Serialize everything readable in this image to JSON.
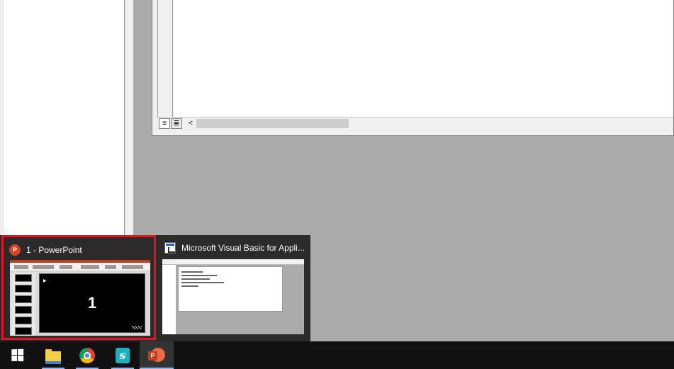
{
  "vba_editor": {
    "scroll_left_glyph": "<",
    "view_procedure_glyph": "≡",
    "view_full_module_glyph": "≣"
  },
  "thumbnails": [
    {
      "title": "1 - PowerPoint",
      "icon": "powerpoint-icon",
      "icon_letter": "P",
      "slide_number": "1",
      "selected": true,
      "highlight_color": "#e81123"
    },
    {
      "title": "Microsoft Visual Basic for Appli...",
      "icon": "vba-editor-icon",
      "selected": false
    }
  ],
  "taskbar": {
    "items": [
      {
        "name": "start",
        "icon": "windows-logo-icon"
      },
      {
        "name": "file-explorer",
        "icon": "folder-icon"
      },
      {
        "name": "chrome",
        "icon": "chrome-icon"
      },
      {
        "name": "surfshark",
        "icon": "surfshark-icon",
        "letter": "s"
      },
      {
        "name": "powerpoint",
        "icon": "powerpoint-icon",
        "letter": "P",
        "active": true
      }
    ],
    "accent_color": "#8ab4f8",
    "background": "#111111"
  }
}
